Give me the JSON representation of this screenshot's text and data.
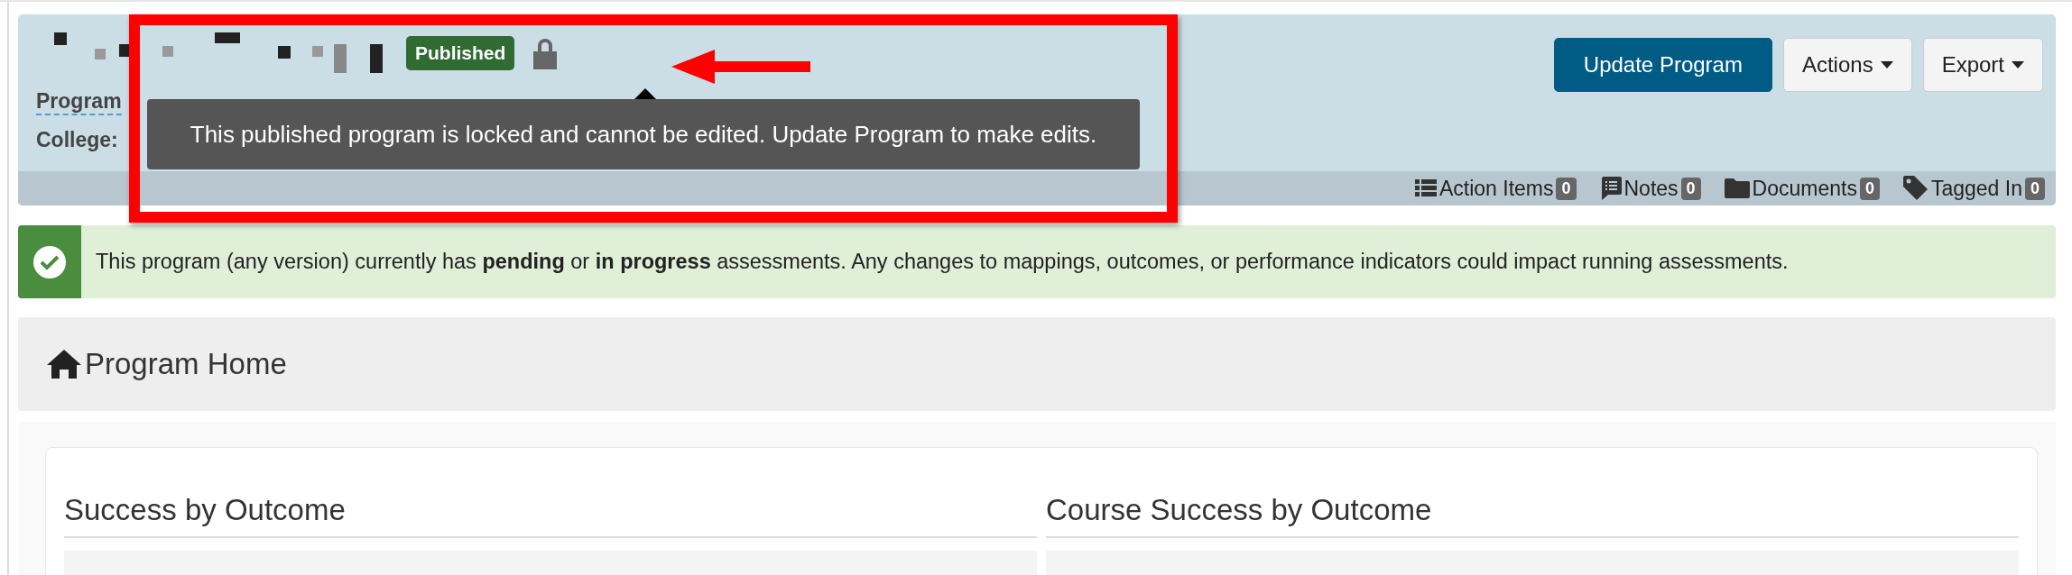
{
  "header": {
    "status_badge": "Published",
    "tooltip": "This published program is locked and cannot be edited. Update Program to make edits.",
    "locked": true,
    "labels": [
      "Program",
      "College:"
    ],
    "buttons": [
      {
        "label": "Update Program",
        "kind": "primary"
      },
      {
        "label": "Actions",
        "kind": "dropdown"
      },
      {
        "label": "Export",
        "kind": "dropdown"
      }
    ],
    "tabs": [
      {
        "label": "Action Items",
        "count": "0"
      },
      {
        "label": "Notes",
        "count": "0"
      },
      {
        "label": "Documents",
        "count": "0"
      },
      {
        "label": "Tagged In",
        "count": "0"
      }
    ]
  },
  "alert": {
    "text": "This program (any version) currently has **pending** or **in progress** assessments. Any changes to mappings, outcomes, or performance indicators could impact running assessments."
  },
  "page_title": "Program Home",
  "sections": [
    "Success by Outcome",
    "Course Success by Outcome"
  ]
}
